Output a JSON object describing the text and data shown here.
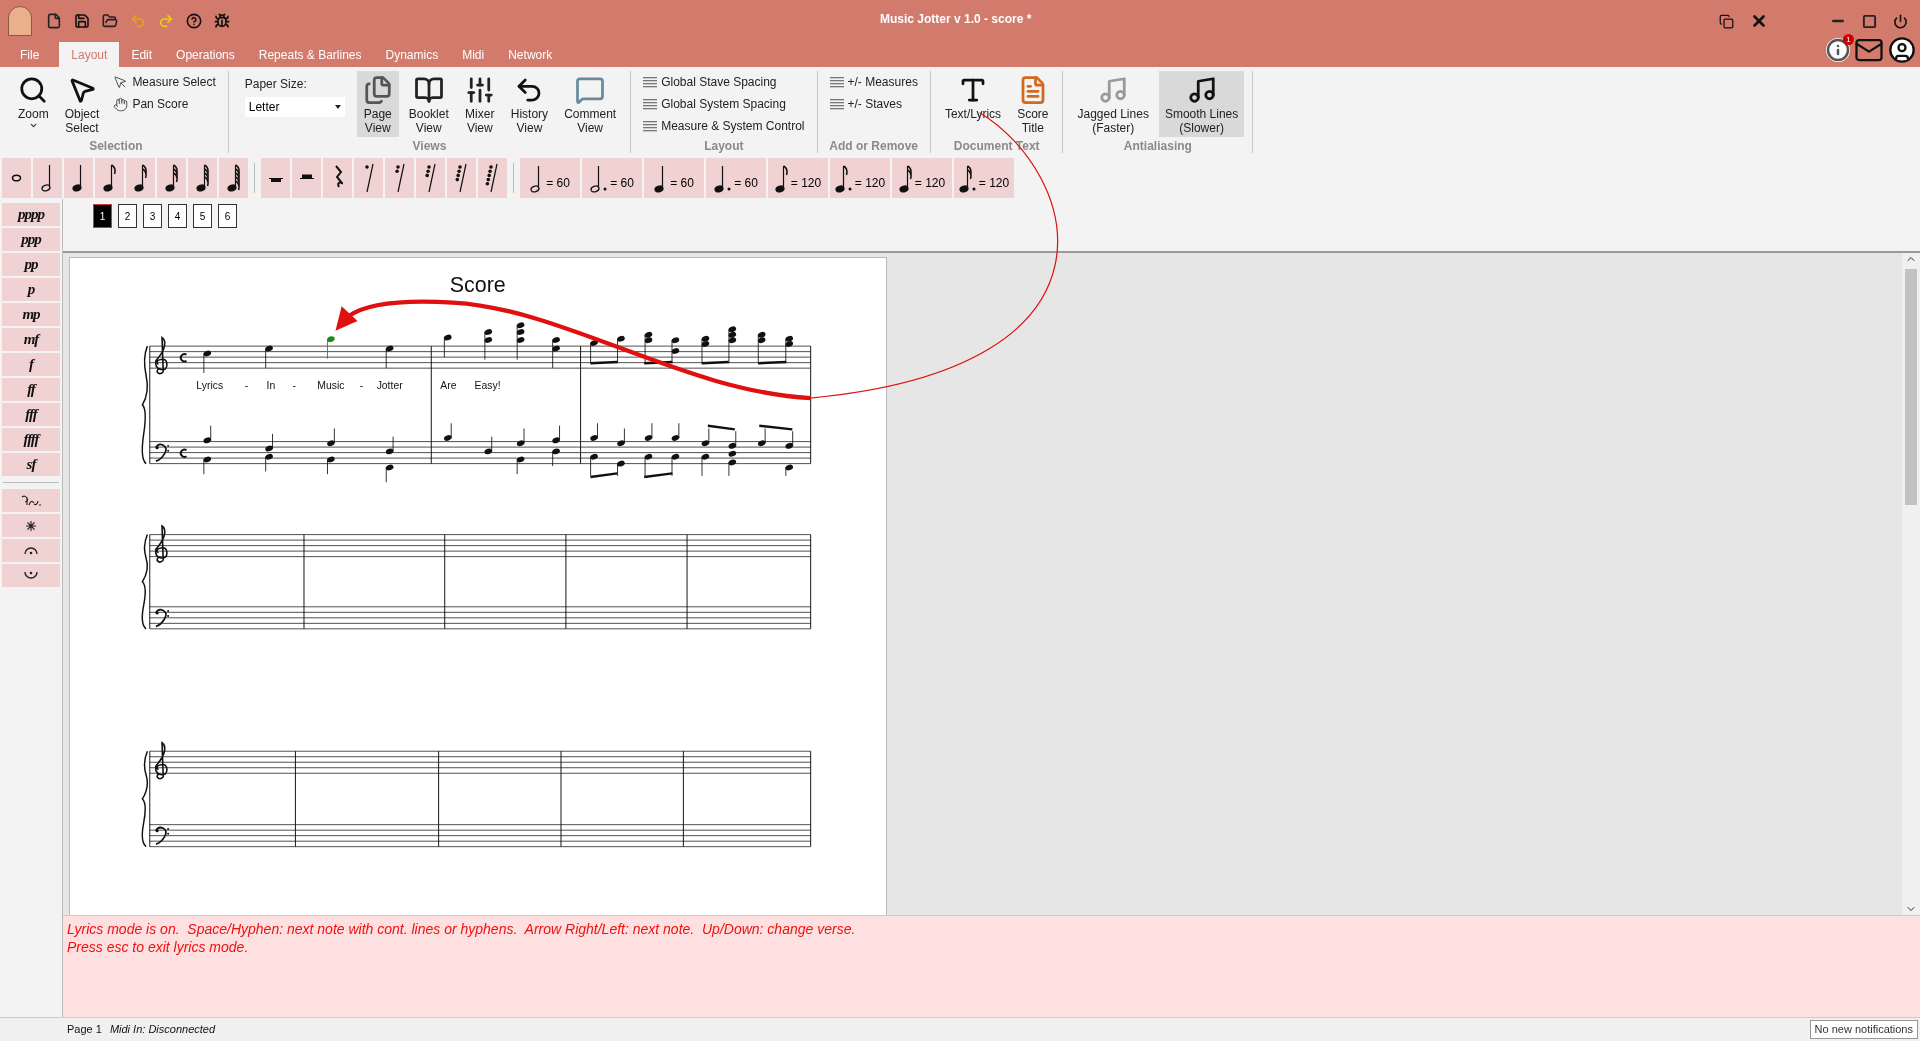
{
  "title_bar": {
    "title": "Music Jotter v 1.0 - score *"
  },
  "notifications": {
    "badge": "1"
  },
  "menu_tabs": [
    {
      "label": "File",
      "selected": false
    },
    {
      "label": "Layout",
      "selected": true
    },
    {
      "label": "Edit",
      "selected": false
    },
    {
      "label": "Operations",
      "selected": false
    },
    {
      "label": "Repeats & Barlines",
      "selected": false
    },
    {
      "label": "Dynamics",
      "selected": false
    },
    {
      "label": "Midi",
      "selected": false
    },
    {
      "label": "Network",
      "selected": false
    }
  ],
  "ribbon": [
    {
      "label": "Selection",
      "items": [
        {
          "kind": "large",
          "label": "Zoom",
          "dropdown": true,
          "selected": false
        },
        {
          "kind": "large",
          "label": "Object\nSelect",
          "selected": false
        },
        {
          "kind": "small",
          "label": "Measure Select",
          "selected": false
        },
        {
          "kind": "small",
          "label": "Pan Score",
          "selected": false
        }
      ]
    },
    {
      "label": "Views",
      "items": [
        {
          "kind": "select",
          "label": "Paper Size:",
          "value": "Letter"
        },
        {
          "kind": "large",
          "label": "Page\nView",
          "selected": true
        },
        {
          "kind": "large",
          "label": "Booklet\nView",
          "selected": false
        },
        {
          "kind": "large",
          "label": "Mixer\nView",
          "selected": false
        },
        {
          "kind": "large",
          "label": "History\nView",
          "selected": false
        },
        {
          "kind": "large",
          "label": "Comment\nView",
          "selected": false
        }
      ]
    },
    {
      "label": "Layout",
      "items": [
        {
          "kind": "small",
          "label": "Global Stave Spacing",
          "selected": false
        },
        {
          "kind": "small",
          "label": "Global System Spacing",
          "selected": false
        },
        {
          "kind": "small",
          "label": "Measure & System Control",
          "selected": false
        }
      ]
    },
    {
      "label": "Add or Remove",
      "items": [
        {
          "kind": "small",
          "label": "+/- Measures",
          "selected": false
        },
        {
          "kind": "small",
          "label": "+/- Staves",
          "selected": false
        }
      ]
    },
    {
      "label": "Document Text",
      "items": [
        {
          "kind": "large",
          "label": "Text/Lyrics",
          "selected": false
        },
        {
          "kind": "large",
          "label": "Score\nTitle",
          "selected": false
        }
      ]
    },
    {
      "label": "Antialiasing",
      "items": [
        {
          "kind": "large",
          "label": "Jagged Lines\n(Faster)",
          "selected": false
        },
        {
          "kind": "large",
          "label": "Smooth Lines\n(Slower)",
          "selected": true
        }
      ]
    }
  ],
  "palette": [
    {
      "kind": "note"
    },
    {
      "kind": "note"
    },
    {
      "kind": "note"
    },
    {
      "kind": "note"
    },
    {
      "kind": "note"
    },
    {
      "kind": "note"
    },
    {
      "kind": "note"
    },
    {
      "kind": "note"
    },
    {
      "kind": "rest"
    },
    {
      "kind": "rest"
    },
    {
      "kind": "rest"
    },
    {
      "kind": "rest"
    },
    {
      "kind": "rest"
    },
    {
      "kind": "rest"
    },
    {
      "kind": "rest"
    },
    {
      "kind": "rest"
    },
    {
      "kind": "tempo",
      "label": "= 60"
    },
    {
      "kind": "tempo",
      "label": "= 60"
    },
    {
      "kind": "tempo",
      "label": "= 60"
    },
    {
      "kind": "tempo",
      "label": "= 60"
    },
    {
      "kind": "tempo",
      "label": "= 120"
    },
    {
      "kind": "tempo",
      "label": "= 120"
    },
    {
      "kind": "tempo",
      "label": "= 120"
    },
    {
      "kind": "tempo",
      "label": "= 120"
    }
  ],
  "page_tabs": [
    {
      "label": "1",
      "selected": true
    },
    {
      "label": "2",
      "selected": false
    },
    {
      "label": "3",
      "selected": false
    },
    {
      "label": "4",
      "selected": false
    },
    {
      "label": "5",
      "selected": false
    },
    {
      "label": "6",
      "selected": false
    }
  ],
  "dynamics": [
    {
      "kind": "dynamic",
      "label": "pppp"
    },
    {
      "kind": "dynamic",
      "label": "ppp"
    },
    {
      "kind": "dynamic",
      "label": "pp"
    },
    {
      "kind": "dynamic",
      "label": "p"
    },
    {
      "kind": "dynamic",
      "label": "mp"
    },
    {
      "kind": "dynamic",
      "label": "mf"
    },
    {
      "kind": "dynamic",
      "label": "f"
    },
    {
      "kind": "dynamic",
      "label": "ff"
    },
    {
      "kind": "dynamic",
      "label": "fff"
    },
    {
      "kind": "dynamic",
      "label": "ffff"
    },
    {
      "kind": "dynamic",
      "label": "sf"
    },
    {
      "kind": "pedal"
    },
    {
      "kind": "pedal-release"
    },
    {
      "kind": "fermata"
    },
    {
      "kind": "fermata-below"
    }
  ],
  "score": {
    "title": "Score",
    "lyrics": [
      "Lyrics",
      "-",
      "In",
      "-",
      "Music",
      "-",
      "Jotter",
      "Are",
      "Easy!"
    ]
  },
  "message": [
    "Lyrics mode is on.  Space/Hyphen: next note with cont. lines or hyphens.  Arrow Right/Left: next note.  Up/Down: change verse.",
    "Press esc to exit lyrics mode."
  ],
  "status_bar": {
    "page": "Page 1",
    "midi": "Midi In: Disconnected",
    "notifications": "No new notifications"
  }
}
